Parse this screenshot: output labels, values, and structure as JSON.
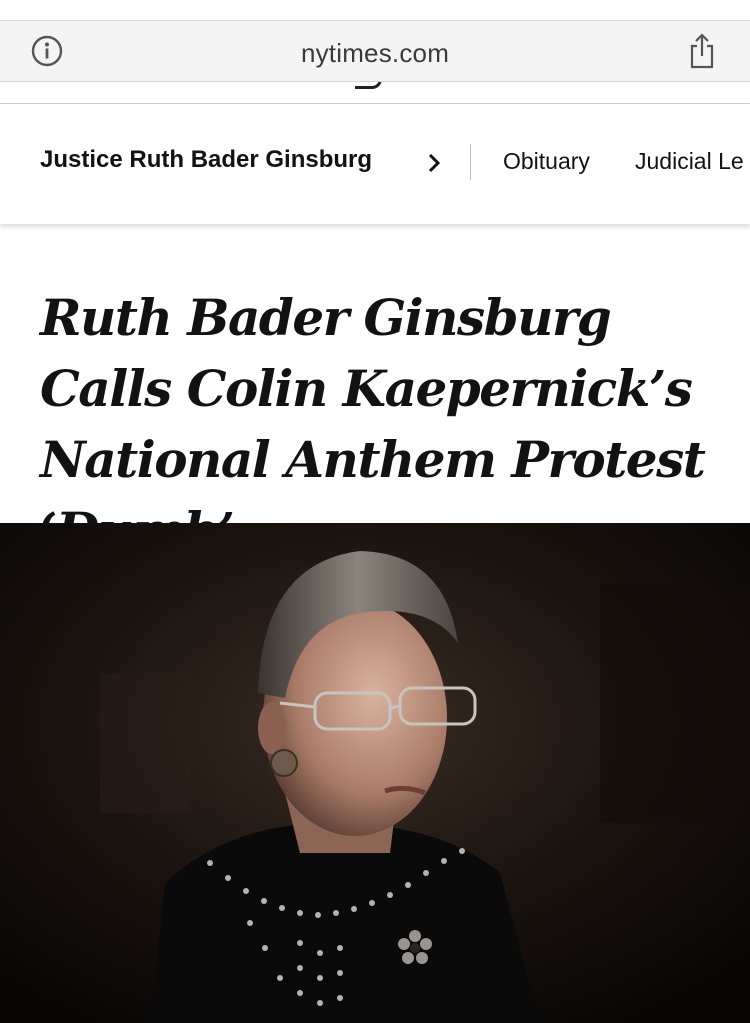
{
  "browser": {
    "url": "nytimes.com",
    "info_icon": "info-circle-icon",
    "share_icon": "share-icon"
  },
  "section_nav": {
    "series_label": "Justice Ruth Bader Ginsburg",
    "chevron_icon": "chevron-right-icon",
    "links": [
      "Obituary",
      "Judicial Le"
    ]
  },
  "article": {
    "headline": "Ruth Bader Ginsburg Calls Colin Kaepernick’s National Anthem Protest ‘Dumb’"
  },
  "colors": {
    "text": "#121212",
    "address_bar_bg": "#f4f4f4",
    "photo_bg": "#0c0907"
  }
}
